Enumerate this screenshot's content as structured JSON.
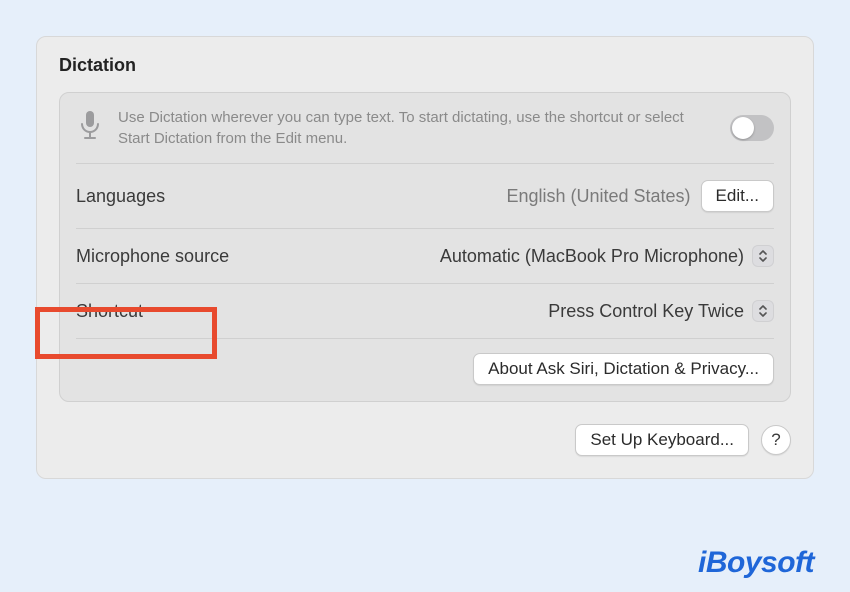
{
  "section_title": "Dictation",
  "info": {
    "text": "Use Dictation wherever you can type text. To start dictating, use the shortcut or select Start Dictation from the Edit menu.",
    "toggle_on": false
  },
  "rows": {
    "languages": {
      "label": "Languages",
      "value": "English (United States)",
      "edit_label": "Edit..."
    },
    "microphone": {
      "label": "Microphone source",
      "value": "Automatic (MacBook Pro Microphone)"
    },
    "shortcut": {
      "label": "Shortcut",
      "value": "Press Control Key Twice"
    }
  },
  "about_button": "About Ask Siri, Dictation & Privacy...",
  "footer": {
    "setup_keyboard": "Set Up Keyboard...",
    "help": "?"
  },
  "watermark": "iBoysoft"
}
